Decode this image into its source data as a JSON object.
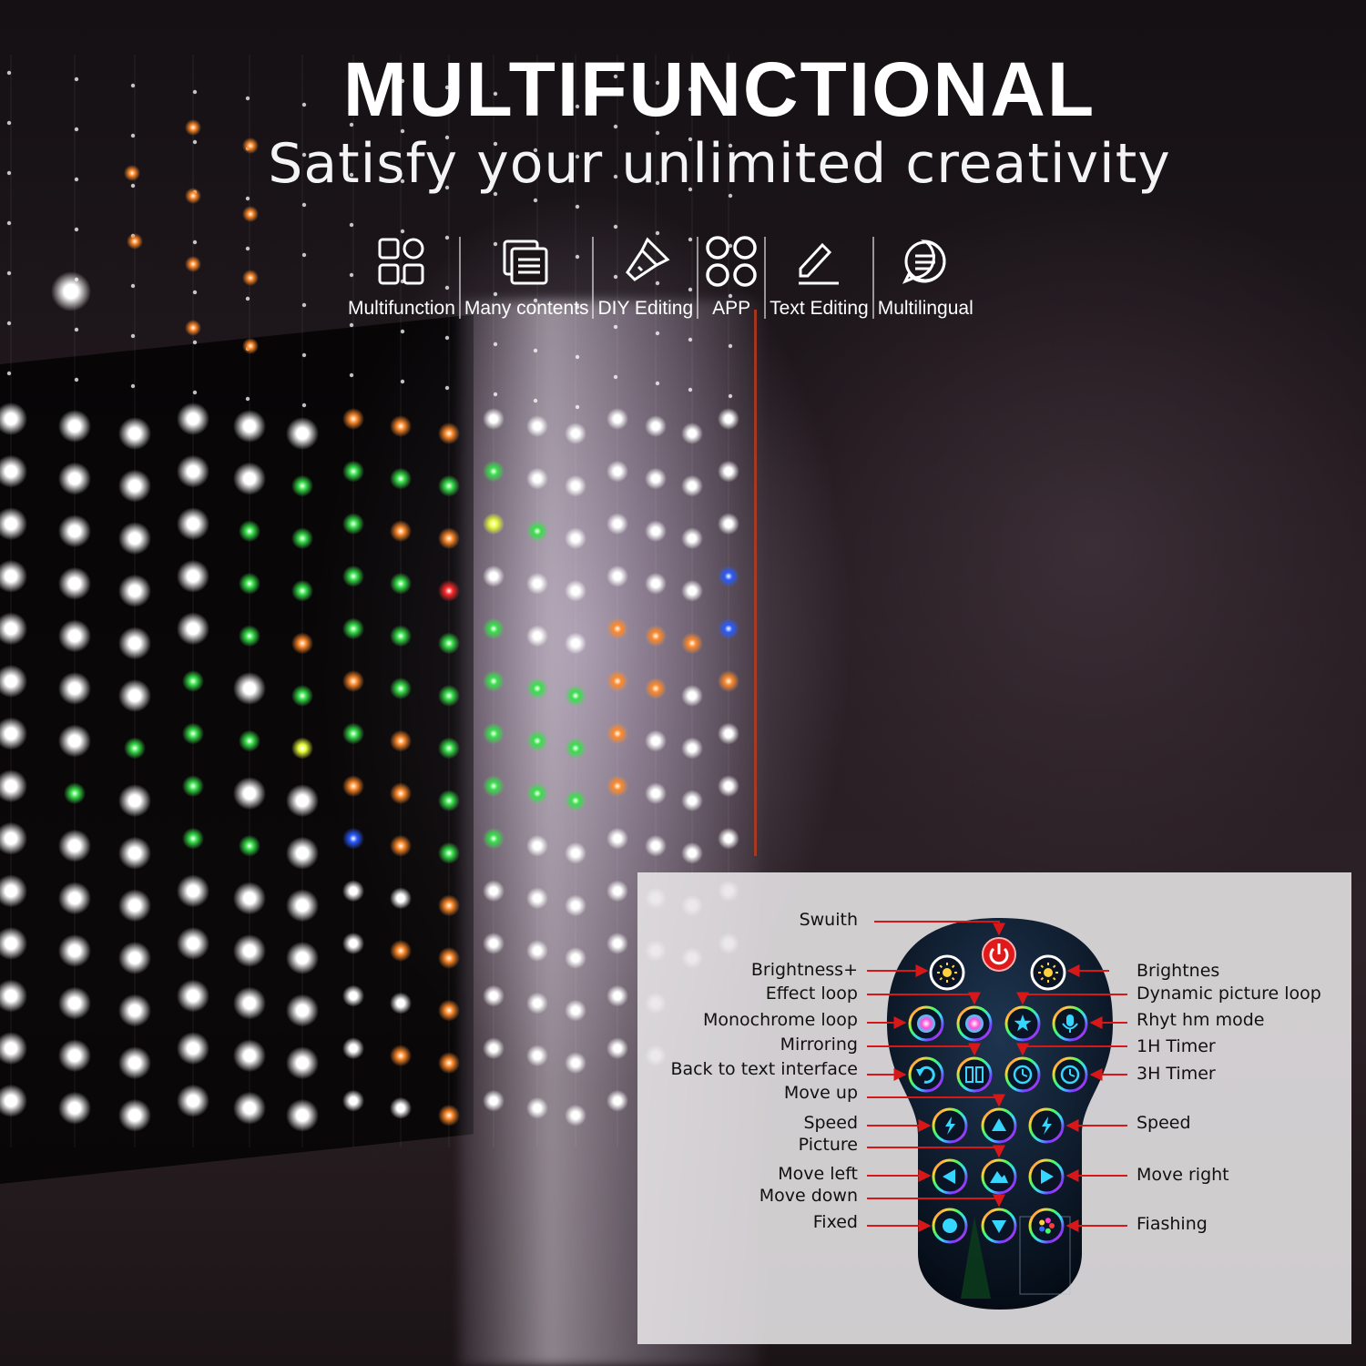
{
  "header": {
    "title": "MULTIFUNCTIONAL",
    "subtitle": "Satisfy your unlimited creativity"
  },
  "features": [
    {
      "label": "Multifunction",
      "icon": "grid-icon"
    },
    {
      "label": "Many contents",
      "icon": "layers-icon"
    },
    {
      "label": "DIY Editing",
      "icon": "flashlight-icon"
    },
    {
      "label": "APP",
      "icon": "app-cluster-icon"
    },
    {
      "label": "Text Editing",
      "icon": "edit-icon"
    },
    {
      "label": "Multilingual",
      "icon": "chat-icon"
    }
  ],
  "remote": {
    "left_labels": {
      "swuith": "Swuith",
      "brightness_plus": "Brightness+",
      "effect_loop": "Effect loop",
      "monochrome_loop": "Monochrome loop",
      "mirroring": "Mirroring",
      "back_to_text": "Back to text interface",
      "move_up": "Move up",
      "speed_left": "Speed",
      "picture": "Picture",
      "move_left": "Move left",
      "move_down": "Move down",
      "fixed": "Fixed"
    },
    "right_labels": {
      "brightnes": "Brightnes",
      "dynamic_loop": "Dynamic picture loop",
      "rhythm_mode": "Rhyt hm mode",
      "timer_1h": "1H Timer",
      "timer_3h": "3H Timer",
      "speed_right": "Speed",
      "move_right": "Move right",
      "flashing": "Fiashing"
    },
    "colors": {
      "arrow": "#d81818",
      "power": "#e01a1a",
      "remote_body": "#0c1a2c"
    }
  }
}
